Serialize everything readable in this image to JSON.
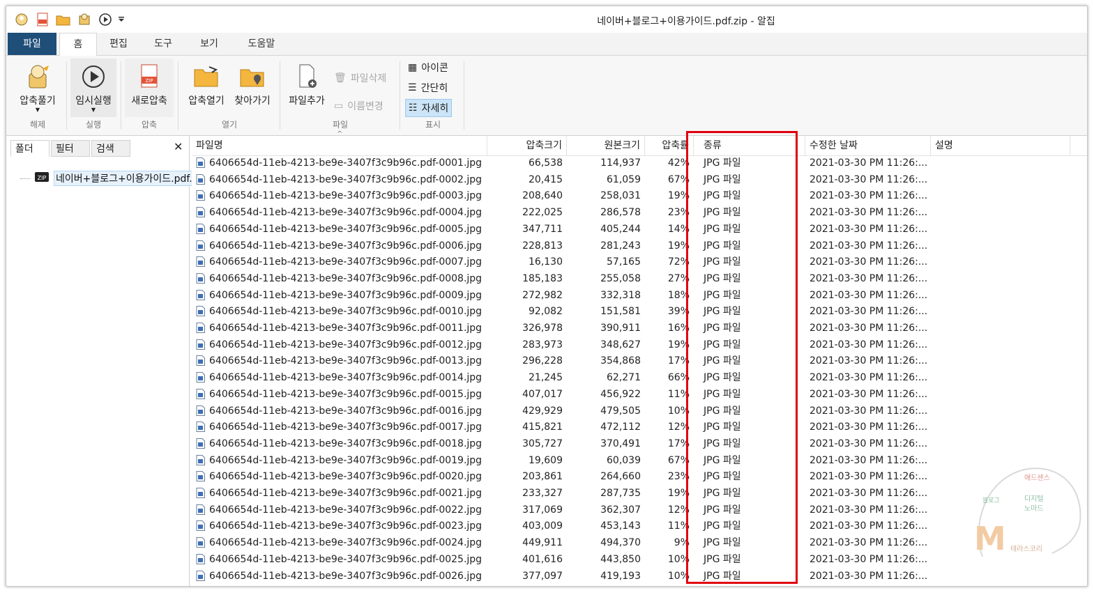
{
  "window": {
    "title": "네이버+블로그+이용가이드.pdf.zip - 알집"
  },
  "qat": {
    "icons": [
      "app-icon",
      "new-zip-icon",
      "open-folder-icon",
      "extract-icon",
      "run-icon",
      "customize-icon"
    ]
  },
  "tabs": [
    {
      "label": "파일"
    },
    {
      "label": "홈"
    },
    {
      "label": "편집"
    },
    {
      "label": "도구"
    },
    {
      "label": "보기"
    },
    {
      "label": "도움말"
    }
  ],
  "ribbon": {
    "extract": {
      "label": "압축풀기",
      "group": "해제"
    },
    "run": {
      "label": "임시실행",
      "group": "실행"
    },
    "new_zip": {
      "label": "새로압축",
      "group": "압축"
    },
    "open_zip": {
      "label": "압축열기"
    },
    "locate": {
      "label": "찾아가기"
    },
    "open_group": "열기",
    "add_file": {
      "label": "파일추가"
    },
    "delete_file": {
      "label": "파일삭제"
    },
    "rename": {
      "label": "이름변경"
    },
    "file_group": "파일",
    "view_icons": {
      "label": "아이콘"
    },
    "view_simple": {
      "label": "간단히"
    },
    "view_detail": {
      "label": "자세히"
    },
    "view_group": "표시"
  },
  "left_pane": {
    "tabs": [
      "폴더",
      "필터",
      "검색"
    ],
    "close": "✕",
    "tree_item": "네이버+블로그+이용가이드.pdf.zip"
  },
  "columns": {
    "name": "파일명",
    "compressed": "압축크기",
    "original": "원본크기",
    "ratio": "압축률",
    "type": "종류",
    "modified": "수정한 날짜",
    "desc": "설명"
  },
  "sort_indicator": "^",
  "files": [
    {
      "name": "6406654d-11eb-4213-be9e-3407f3c9b96c.pdf-0001.jpg",
      "compressed": "66,538",
      "original": "114,937",
      "ratio": "42%",
      "type": "JPG 파일",
      "modified": "2021-03-30 PM 11:26:..."
    },
    {
      "name": "6406654d-11eb-4213-be9e-3407f3c9b96c.pdf-0002.jpg",
      "compressed": "20,415",
      "original": "61,059",
      "ratio": "67%",
      "type": "JPG 파일",
      "modified": "2021-03-30 PM 11:26:..."
    },
    {
      "name": "6406654d-11eb-4213-be9e-3407f3c9b96c.pdf-0003.jpg",
      "compressed": "208,640",
      "original": "258,031",
      "ratio": "19%",
      "type": "JPG 파일",
      "modified": "2021-03-30 PM 11:26:..."
    },
    {
      "name": "6406654d-11eb-4213-be9e-3407f3c9b96c.pdf-0004.jpg",
      "compressed": "222,025",
      "original": "286,578",
      "ratio": "23%",
      "type": "JPG 파일",
      "modified": "2021-03-30 PM 11:26:..."
    },
    {
      "name": "6406654d-11eb-4213-be9e-3407f3c9b96c.pdf-0005.jpg",
      "compressed": "347,711",
      "original": "405,244",
      "ratio": "14%",
      "type": "JPG 파일",
      "modified": "2021-03-30 PM 11:26:..."
    },
    {
      "name": "6406654d-11eb-4213-be9e-3407f3c9b96c.pdf-0006.jpg",
      "compressed": "228,813",
      "original": "281,243",
      "ratio": "19%",
      "type": "JPG 파일",
      "modified": "2021-03-30 PM 11:26:..."
    },
    {
      "name": "6406654d-11eb-4213-be9e-3407f3c9b96c.pdf-0007.jpg",
      "compressed": "16,130",
      "original": "57,165",
      "ratio": "72%",
      "type": "JPG 파일",
      "modified": "2021-03-30 PM 11:26:..."
    },
    {
      "name": "6406654d-11eb-4213-be9e-3407f3c9b96c.pdf-0008.jpg",
      "compressed": "185,183",
      "original": "255,058",
      "ratio": "27%",
      "type": "JPG 파일",
      "modified": "2021-03-30 PM 11:26:..."
    },
    {
      "name": "6406654d-11eb-4213-be9e-3407f3c9b96c.pdf-0009.jpg",
      "compressed": "272,982",
      "original": "332,318",
      "ratio": "18%",
      "type": "JPG 파일",
      "modified": "2021-03-30 PM 11:26:..."
    },
    {
      "name": "6406654d-11eb-4213-be9e-3407f3c9b96c.pdf-0010.jpg",
      "compressed": "92,082",
      "original": "151,581",
      "ratio": "39%",
      "type": "JPG 파일",
      "modified": "2021-03-30 PM 11:26:..."
    },
    {
      "name": "6406654d-11eb-4213-be9e-3407f3c9b96c.pdf-0011.jpg",
      "compressed": "326,978",
      "original": "390,911",
      "ratio": "16%",
      "type": "JPG 파일",
      "modified": "2021-03-30 PM 11:26:..."
    },
    {
      "name": "6406654d-11eb-4213-be9e-3407f3c9b96c.pdf-0012.jpg",
      "compressed": "283,973",
      "original": "348,627",
      "ratio": "19%",
      "type": "JPG 파일",
      "modified": "2021-03-30 PM 11:26:..."
    },
    {
      "name": "6406654d-11eb-4213-be9e-3407f3c9b96c.pdf-0013.jpg",
      "compressed": "296,228",
      "original": "354,868",
      "ratio": "17%",
      "type": "JPG 파일",
      "modified": "2021-03-30 PM 11:26:..."
    },
    {
      "name": "6406654d-11eb-4213-be9e-3407f3c9b96c.pdf-0014.jpg",
      "compressed": "21,245",
      "original": "62,271",
      "ratio": "66%",
      "type": "JPG 파일",
      "modified": "2021-03-30 PM 11:26:..."
    },
    {
      "name": "6406654d-11eb-4213-be9e-3407f3c9b96c.pdf-0015.jpg",
      "compressed": "407,017",
      "original": "456,922",
      "ratio": "11%",
      "type": "JPG 파일",
      "modified": "2021-03-30 PM 11:26:..."
    },
    {
      "name": "6406654d-11eb-4213-be9e-3407f3c9b96c.pdf-0016.jpg",
      "compressed": "429,929",
      "original": "479,505",
      "ratio": "10%",
      "type": "JPG 파일",
      "modified": "2021-03-30 PM 11:26:..."
    },
    {
      "name": "6406654d-11eb-4213-be9e-3407f3c9b96c.pdf-0017.jpg",
      "compressed": "415,821",
      "original": "472,112",
      "ratio": "12%",
      "type": "JPG 파일",
      "modified": "2021-03-30 PM 11:26:..."
    },
    {
      "name": "6406654d-11eb-4213-be9e-3407f3c9b96c.pdf-0018.jpg",
      "compressed": "305,727",
      "original": "370,491",
      "ratio": "17%",
      "type": "JPG 파일",
      "modified": "2021-03-30 PM 11:26:..."
    },
    {
      "name": "6406654d-11eb-4213-be9e-3407f3c9b96c.pdf-0019.jpg",
      "compressed": "19,609",
      "original": "60,039",
      "ratio": "67%",
      "type": "JPG 파일",
      "modified": "2021-03-30 PM 11:26:..."
    },
    {
      "name": "6406654d-11eb-4213-be9e-3407f3c9b96c.pdf-0020.jpg",
      "compressed": "203,861",
      "original": "264,660",
      "ratio": "23%",
      "type": "JPG 파일",
      "modified": "2021-03-30 PM 11:26:..."
    },
    {
      "name": "6406654d-11eb-4213-be9e-3407f3c9b96c.pdf-0021.jpg",
      "compressed": "233,327",
      "original": "287,735",
      "ratio": "19%",
      "type": "JPG 파일",
      "modified": "2021-03-30 PM 11:26:..."
    },
    {
      "name": "6406654d-11eb-4213-be9e-3407f3c9b96c.pdf-0022.jpg",
      "compressed": "317,069",
      "original": "362,307",
      "ratio": "12%",
      "type": "JPG 파일",
      "modified": "2021-03-30 PM 11:26:..."
    },
    {
      "name": "6406654d-11eb-4213-be9e-3407f3c9b96c.pdf-0023.jpg",
      "compressed": "403,009",
      "original": "453,143",
      "ratio": "11%",
      "type": "JPG 파일",
      "modified": "2021-03-30 PM 11:26:..."
    },
    {
      "name": "6406654d-11eb-4213-be9e-3407f3c9b96c.pdf-0024.jpg",
      "compressed": "449,911",
      "original": "494,370",
      "ratio": "9%",
      "type": "JPG 파일",
      "modified": "2021-03-30 PM 11:26:..."
    },
    {
      "name": "6406654d-11eb-4213-be9e-3407f3c9b96c.pdf-0025.jpg",
      "compressed": "401,616",
      "original": "443,850",
      "ratio": "10%",
      "type": "JPG 파일",
      "modified": "2021-03-30 PM 11:26:..."
    },
    {
      "name": "6406654d-11eb-4213-be9e-3407f3c9b96c.pdf-0026.jpg",
      "compressed": "377,097",
      "original": "419,193",
      "ratio": "10%",
      "type": "JPG 파일",
      "modified": "2021-03-30 PM 11:26:..."
    }
  ],
  "watermark": {
    "words": [
      "애드센스",
      "디지털",
      "노마드",
      "블로그",
      "M",
      "테라스코리"
    ]
  },
  "colors": {
    "file_tab": "#1f4e79",
    "highlight": "#e0000f",
    "selected_view": "#cce4f7"
  }
}
